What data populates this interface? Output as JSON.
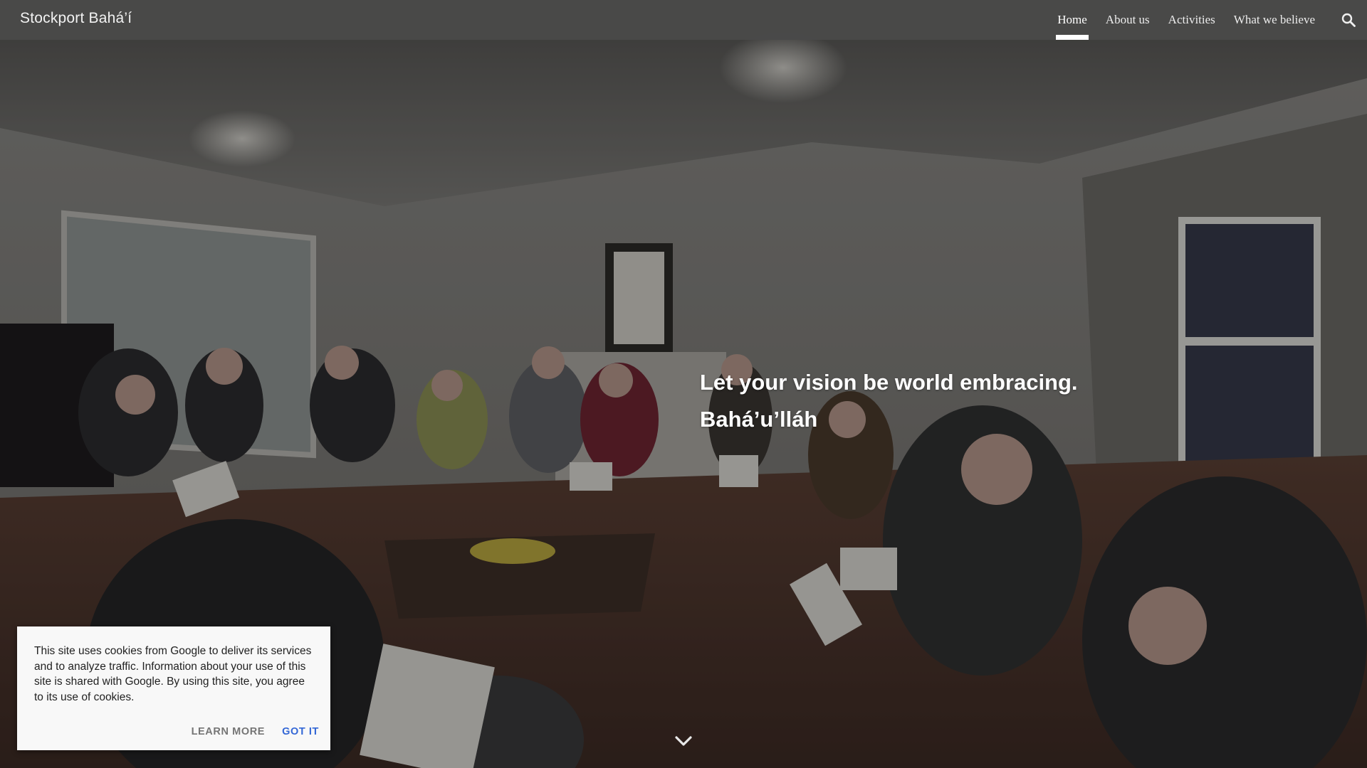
{
  "site": {
    "title": "Stockport Bahá’í"
  },
  "nav": {
    "items": [
      {
        "label": "Home",
        "active": true
      },
      {
        "label": "About us",
        "active": false
      },
      {
        "label": "Activities",
        "active": false
      },
      {
        "label": "What we believe",
        "active": false
      }
    ],
    "search_icon": "search-icon"
  },
  "hero": {
    "quote_line": "Let your vision be world embracing.",
    "attribution": "Bahá’u’lláh",
    "scroll_icon": "chevron-down-icon"
  },
  "cookie_banner": {
    "message": "This site uses cookies from Google to deliver its services and to analyze traffic. Information about your use of this site is shared with Google. By using this site, you agree to its use of cookies.",
    "learn_more": "LEARN MORE",
    "got_it": "GOT IT"
  },
  "colors": {
    "topbar": "#484848",
    "accent_link": "#3367d6",
    "banner_bg": "#f8f8f8"
  }
}
